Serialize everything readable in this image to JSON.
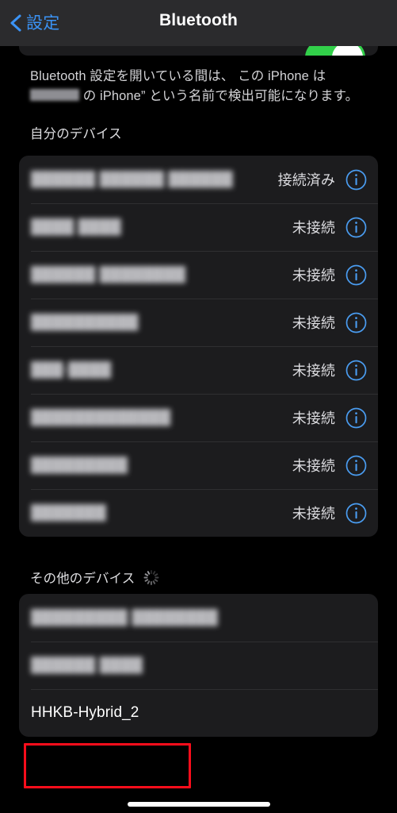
{
  "navbar": {
    "back_label": "設定",
    "back_icon": "chevron-left-icon",
    "title": "Bluetooth"
  },
  "toggle": {
    "state": "on",
    "color": "#32d04a"
  },
  "footnote": {
    "line1": "Bluetooth 設定を開いている間は、 この iPhone は",
    "line2_suffix": "の iPhone” という名前で検出可能になります。",
    "redacted": true
  },
  "sections": [
    {
      "id": "my-devices",
      "header": "自分のデバイス",
      "spinner": false,
      "rows": [
        {
          "name": "██████ ██████ ██████",
          "redacted": true,
          "status": "接続済み",
          "info": "info-icon"
        },
        {
          "name": "████ ████",
          "redacted": true,
          "status": "未接続",
          "info": "info-icon"
        },
        {
          "name": "██████ ████████",
          "redacted": true,
          "status": "未接続",
          "info": "info-icon"
        },
        {
          "name": "██████████",
          "redacted": true,
          "status": "未接続",
          "info": "info-icon"
        },
        {
          "name": "███-████",
          "redacted": true,
          "status": "未接続",
          "info": "info-icon"
        },
        {
          "name": "█████████████",
          "redacted": true,
          "status": "未接続",
          "info": "info-icon"
        },
        {
          "name": "█████████",
          "redacted": true,
          "status": "未接続",
          "info": "info-icon"
        },
        {
          "name": "███████",
          "redacted": true,
          "status": "未接続",
          "info": "info-icon"
        }
      ]
    },
    {
      "id": "other-devices",
      "header": "その他のデバイス",
      "spinner": true,
      "spinner_icon": "activity-spinner-icon",
      "rows": [
        {
          "name": "█████████ ████████",
          "redacted": true,
          "status": "",
          "info": null
        },
        {
          "name": "██████ ████",
          "redacted": true,
          "status": "",
          "info": null
        },
        {
          "name": "HHKB-Hybrid_2",
          "redacted": false,
          "status": "",
          "info": null
        }
      ]
    }
  ],
  "annotation": {
    "type": "highlight-rectangle",
    "color": "#fc0d1b",
    "target": "HHKB-Hybrid_2"
  },
  "home_indicator": {
    "visible": true
  }
}
